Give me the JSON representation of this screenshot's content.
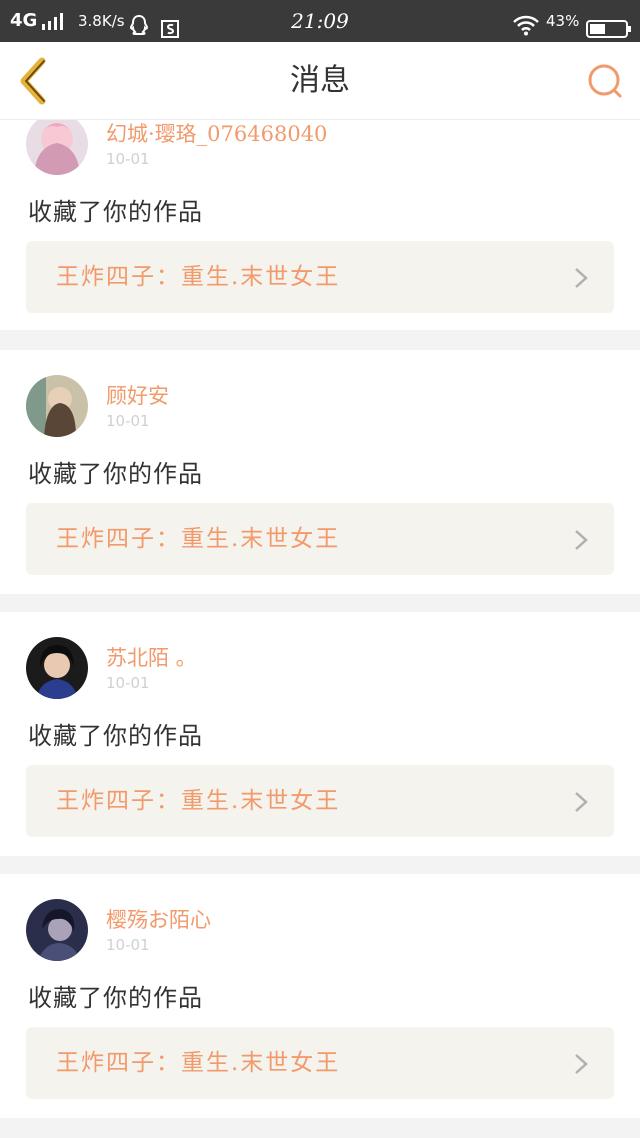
{
  "status_bar": {
    "network": "4G",
    "speed": "3.8K/s",
    "time": "21:09",
    "battery": "43%"
  },
  "header": {
    "title": "消息"
  },
  "messages": [
    {
      "username": "幻城·璎珞_076468040",
      "date": "10-01",
      "action": "收藏了你的作品",
      "work_title": "王炸四子：重生.末世女王"
    },
    {
      "username": "顾好安",
      "date": "10-01",
      "action": "收藏了你的作品",
      "work_title": "王炸四子：重生.末世女王"
    },
    {
      "username": "苏北陌 。",
      "date": "10-01",
      "action": "收藏了你的作品",
      "work_title": "王炸四子：重生.末世女王"
    },
    {
      "username": "樱殇お陌心",
      "date": "10-01",
      "action": "收藏了你的作品",
      "work_title": "王炸四子：重生.末世女王"
    }
  ],
  "colors": {
    "accent": "#f29a6b",
    "back_arrow": "#e5b33c",
    "statusbar": "#3a3a3a",
    "card_bg": "#ffffff",
    "work_bg": "#f4f3ee"
  }
}
